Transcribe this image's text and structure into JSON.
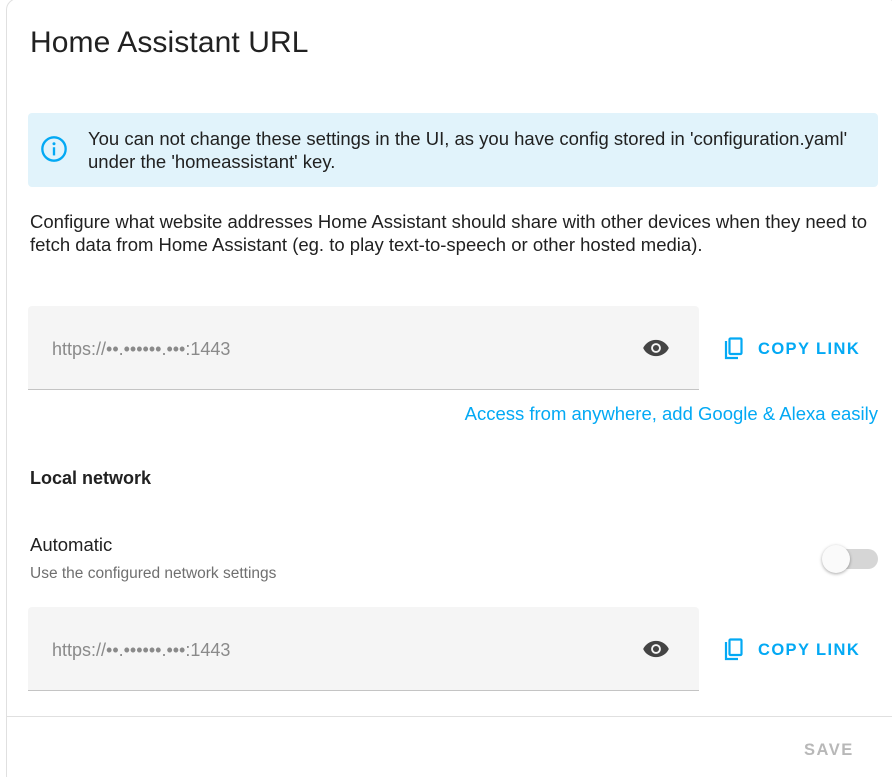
{
  "header": {
    "title": "Home Assistant URL"
  },
  "alert": {
    "icon": "info-icon",
    "text": "You can not change these settings in the UI, as you have config stored in 'configuration.yaml' under the 'homeassistant' key."
  },
  "description": "Configure what website addresses Home Assistant should share with other devices when they need to fetch data from Home Assistant (eg. to play text-to-speech or other hosted media).",
  "external_url": {
    "value": "https://••.••••••.•••:1443",
    "reveal_icon": "eye-icon",
    "copy_label": "COPY LINK"
  },
  "cloud_link": "Access from anywhere, add Google & Alexa easily",
  "local_network": {
    "title": "Local network",
    "automatic_label": "Automatic",
    "automatic_description": "Use the configured network settings",
    "automatic_enabled": false,
    "url_value": "https://••.••••••.•••:1443",
    "copy_label": "COPY LINK"
  },
  "footer": {
    "save_label": "SAVE"
  },
  "colors": {
    "accent": "#03a9f4",
    "alert_background": "#e1f3fb",
    "field_background": "#f5f5f5",
    "disabled_text": "#b8b8b8"
  }
}
